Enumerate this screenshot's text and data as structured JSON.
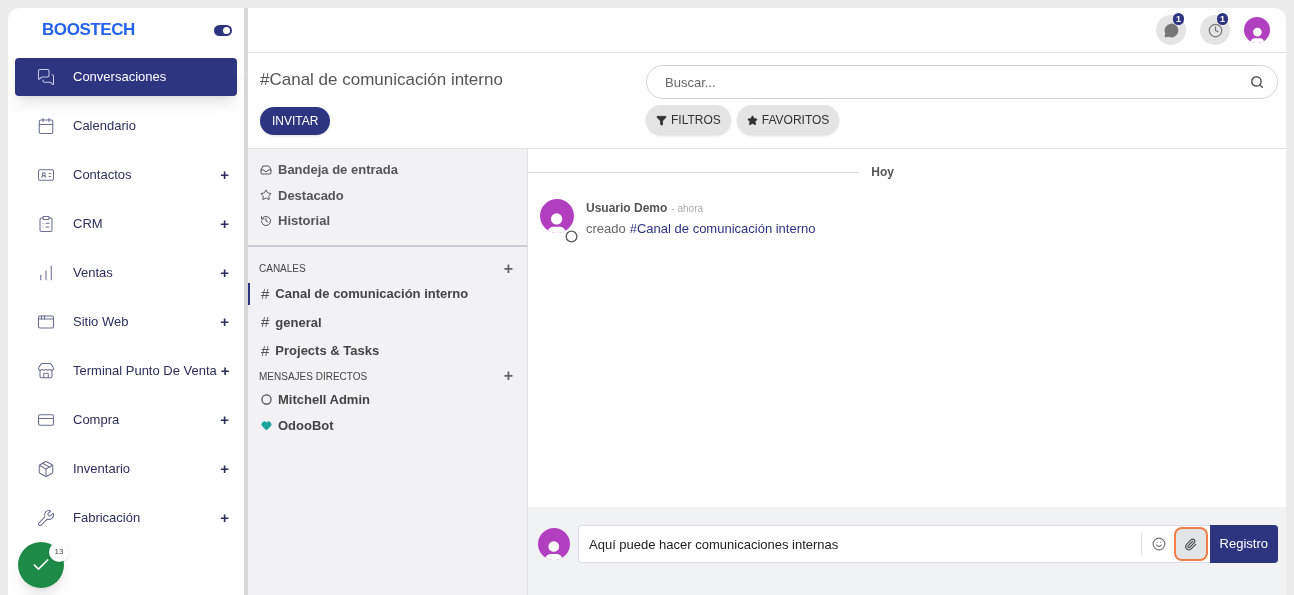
{
  "brand": {
    "name": "BOOSTECH",
    "theme_toggle_on": true
  },
  "sidebar": {
    "items": [
      {
        "label": "Conversaciones",
        "selected": true
      },
      {
        "label": "Calendario",
        "selected": false
      },
      {
        "label": "Contactos",
        "selected": false,
        "toggle": "+"
      },
      {
        "label": "CRM",
        "selected": false,
        "toggle": "+"
      },
      {
        "label": "Ventas",
        "selected": false,
        "toggle": "+"
      },
      {
        "label": "Sitio Web",
        "selected": false,
        "toggle": "+"
      },
      {
        "label": "Terminal Punto De Venta",
        "selected": false,
        "toggle": "+"
      },
      {
        "label": "Compra",
        "selected": false,
        "toggle": "+"
      },
      {
        "label": "Inventario",
        "selected": false,
        "toggle": "+"
      },
      {
        "label": "Fabricación",
        "selected": false,
        "toggle": "+"
      }
    ]
  },
  "floating_badge": {
    "count": "13"
  },
  "topbar": {
    "messages_count": "1",
    "activities_count": "1"
  },
  "header": {
    "title": "#Canal de comunicación interno",
    "invite_button": "INVITAR",
    "search": {
      "placeholder": "Buscar..."
    },
    "filter_buttons": [
      {
        "label": "FILTROS"
      },
      {
        "label": "FAVORITOS"
      }
    ]
  },
  "mailboxes": [
    {
      "label": "Bandeja de entrada"
    },
    {
      "label": "Destacado"
    },
    {
      "label": "Historial"
    }
  ],
  "channels": {
    "heading": "CANALES",
    "add": "+",
    "items": [
      {
        "symbol": "#",
        "label": "Canal de comunicación interno",
        "selected": true
      },
      {
        "symbol": "#",
        "label": "general",
        "selected": false
      },
      {
        "symbol": "#",
        "label": "Projects & Tasks",
        "selected": false
      }
    ]
  },
  "direct_messages": {
    "heading": "MENSAJES DIRECTOS",
    "add": "+",
    "items": [
      {
        "label": "Mitchell Admin",
        "kind": "user"
      },
      {
        "label": "OdooBot",
        "kind": "bot"
      }
    ]
  },
  "thread": {
    "date_separator": "Hoy",
    "messages": [
      {
        "author": "Usuario Demo",
        "time": "- ahora",
        "text": "creado",
        "link": "#Canal de comunicación interno"
      }
    ]
  },
  "composer": {
    "value": "Aquí puede hacer comunicaciones internas",
    "attach_highlighted": true,
    "send_button": "Registro"
  }
}
